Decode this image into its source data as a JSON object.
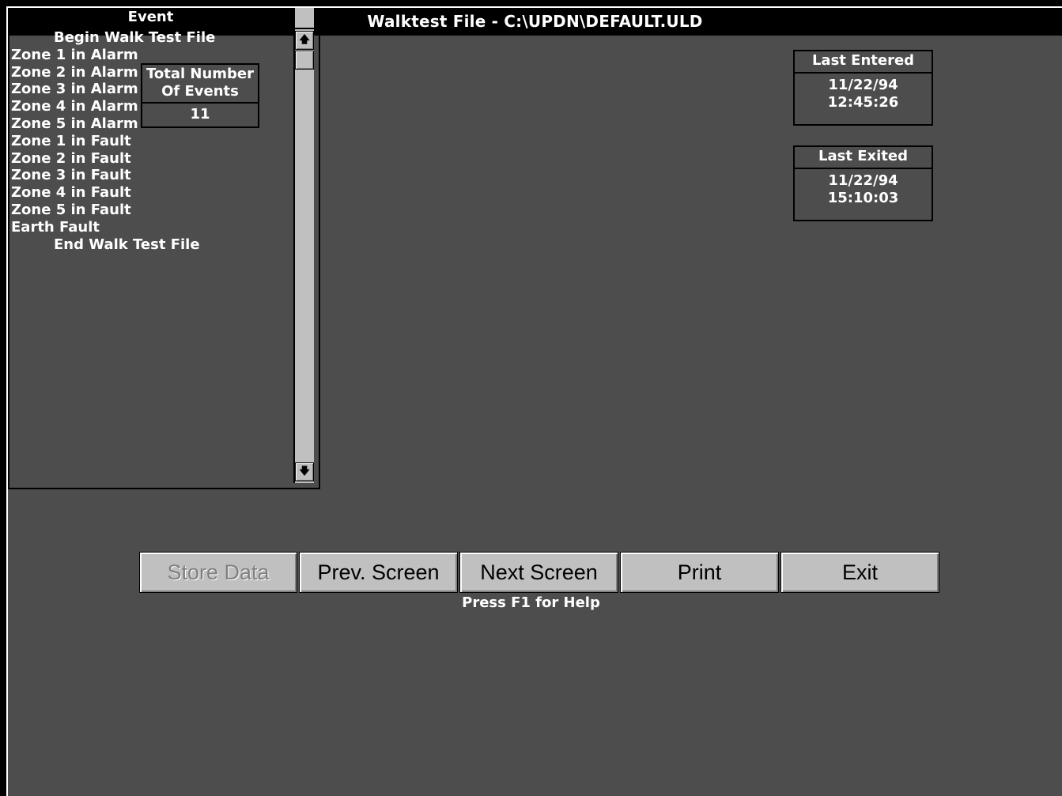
{
  "window": {
    "title": "Walktest File - C:\\UPDN\\DEFAULT.ULD"
  },
  "total_events": {
    "label_line1": "Total Number",
    "label_line2": "Of Events",
    "value": "11"
  },
  "event_list": {
    "header": "Event",
    "items": [
      {
        "label": "Begin Walk Test File"
      },
      {
        "label": "Zone 1 in Alarm"
      },
      {
        "label": "Zone 2 in Alarm"
      },
      {
        "label": "Zone 3 in Alarm"
      },
      {
        "label": "Zone 4 in Alarm"
      },
      {
        "label": "Zone 5 in Alarm"
      },
      {
        "label": "Zone 1 in Fault"
      },
      {
        "label": "Zone 2 in Fault"
      },
      {
        "label": "Zone 3 in Fault"
      },
      {
        "label": "Zone 4 in Fault"
      },
      {
        "label": "Zone 5 in Fault"
      },
      {
        "label": "Earth Fault"
      },
      {
        "label": "End Walk Test File"
      }
    ],
    "scroll_up_icon": "arrow-up-icon",
    "scroll_down_icon": "arrow-down-icon"
  },
  "last_entered": {
    "label": "Last Entered",
    "date": "11/22/94",
    "time": "12:45:26"
  },
  "last_exited": {
    "label": "Last Exited",
    "date": "11/22/94",
    "time": "15:10:03"
  },
  "buttons": {
    "store": "Store Data",
    "prev": "Prev. Screen",
    "next": "Next Screen",
    "print": "Print",
    "exit": "Exit"
  },
  "help_text": "Press F1 for Help"
}
